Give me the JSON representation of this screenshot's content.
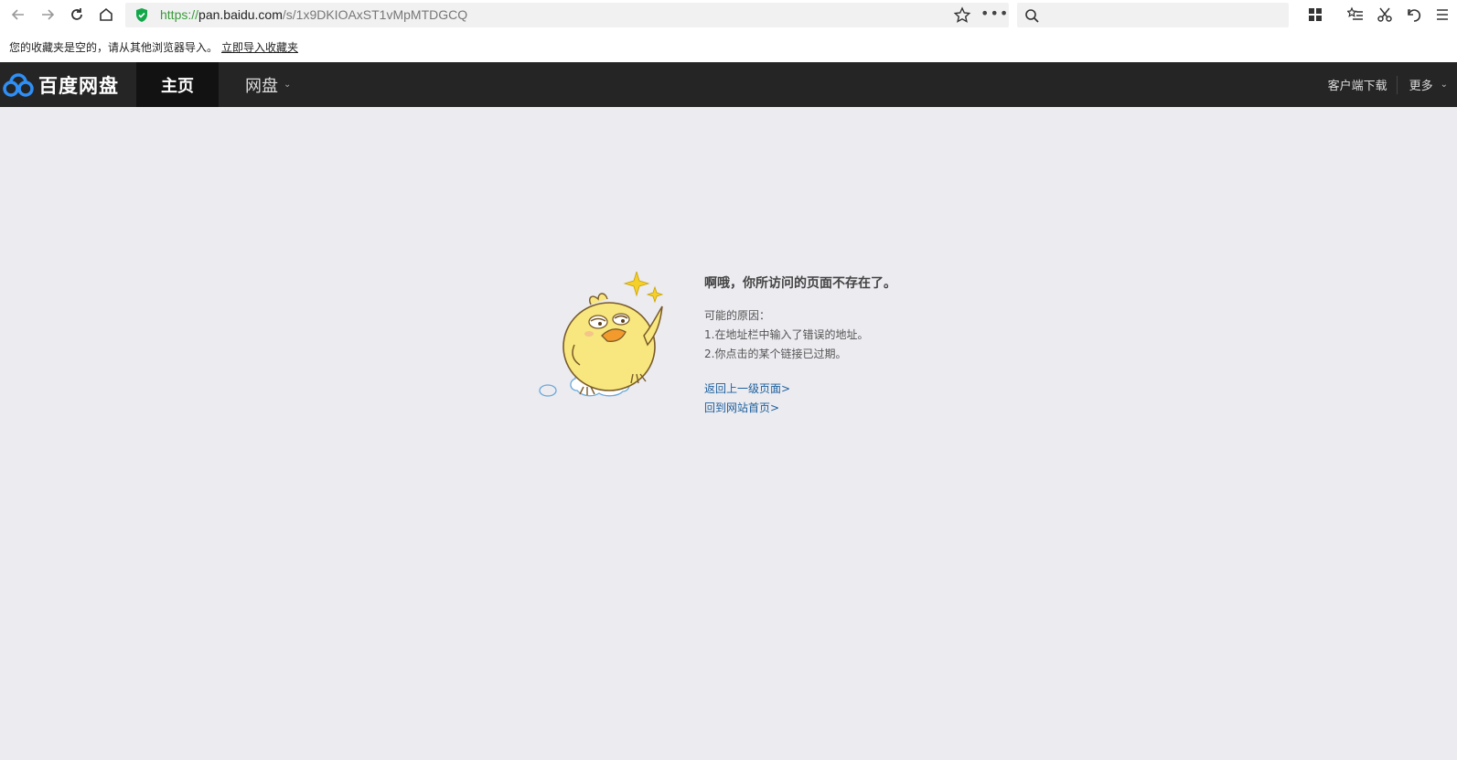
{
  "browser": {
    "url_protocol": "https://",
    "url_host": "pan.baidu.com",
    "url_path": "/s/1x9DKIOAxST1vMpMTDGCQ",
    "overflow_dots": "•••"
  },
  "bookmarks_bar": {
    "message": "您的收藏夹是空的，请从其他浏览器导入。",
    "import_link": "立即导入收藏夹"
  },
  "site_header": {
    "logo_text": "百度网盘",
    "nav_home": "主页",
    "nav_disk": "网盘",
    "client_download": "客户端下载",
    "more": "更多"
  },
  "error_page": {
    "title": "啊哦，你所访问的页面不存在了。",
    "reasons_heading": "可能的原因：",
    "reasons": [
      "1.在地址栏中输入了错误的地址。",
      "2.你点击的某个链接已过期。"
    ],
    "link_back": "返回上一级页面>",
    "link_home": "回到网站首页>"
  },
  "colors": {
    "header_bg": "#252525",
    "home_tab_bg": "#121212",
    "page_bg": "#ebebf0",
    "link": "#1d5f9c",
    "secure_green": "#12a84a"
  }
}
